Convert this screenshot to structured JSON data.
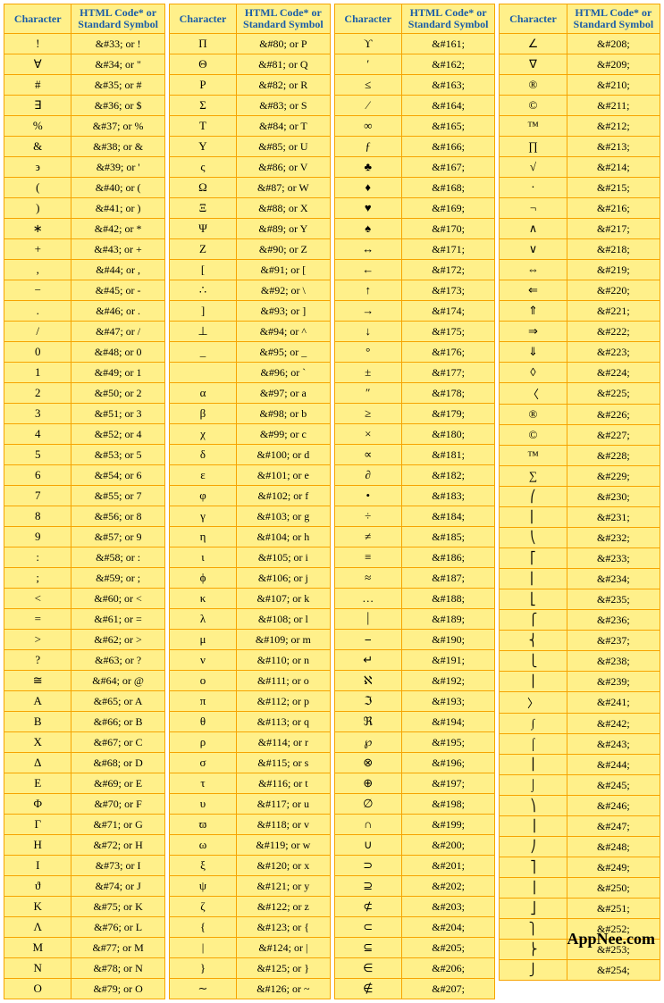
{
  "headers": {
    "char": "Character",
    "code": "HTML Code* or Standard Symbol"
  },
  "brand": "AppNee.com",
  "columns": [
    [
      [
        "!",
        "&#33;  or  !"
      ],
      [
        "∀",
        "&#34;  or  \""
      ],
      [
        "#",
        "&#35;  or  #"
      ],
      [
        "∃",
        "&#36;  or  $"
      ],
      [
        "%",
        "&#37;  or  %"
      ],
      [
        "&",
        "&#38;  or  &"
      ],
      [
        "϶",
        "&#39;  or  '"
      ],
      [
        "(",
        "&#40;  or  ("
      ],
      [
        ")",
        "&#41;  or  )"
      ],
      [
        "∗",
        "&#42;  or  *"
      ],
      [
        "+",
        "&#43;  or  +"
      ],
      [
        ",",
        "&#44;  or  ,"
      ],
      [
        "−",
        "&#45;  or  -"
      ],
      [
        ".",
        "&#46;  or  ."
      ],
      [
        "/",
        "&#47;  or  /"
      ],
      [
        "0",
        "&#48;  or  0"
      ],
      [
        "1",
        "&#49;  or  1"
      ],
      [
        "2",
        "&#50;  or  2"
      ],
      [
        "3",
        "&#51;  or  3"
      ],
      [
        "4",
        "&#52;  or  4"
      ],
      [
        "5",
        "&#53;  or  5"
      ],
      [
        "6",
        "&#54;  or  6"
      ],
      [
        "7",
        "&#55;  or  7"
      ],
      [
        "8",
        "&#56;  or  8"
      ],
      [
        "9",
        "&#57;  or  9"
      ],
      [
        ":",
        "&#58;  or  :"
      ],
      [
        ";",
        "&#59;  or  ;"
      ],
      [
        "<",
        "&#60;  or  <"
      ],
      [
        "=",
        "&#61;  or  ="
      ],
      [
        ">",
        "&#62;  or  >"
      ],
      [
        "?",
        "&#63;  or  ?"
      ],
      [
        "≅",
        "&#64;  or  @"
      ],
      [
        "Α",
        "&#65;  or  A"
      ],
      [
        "Β",
        "&#66;  or  B"
      ],
      [
        "Χ",
        "&#67;  or  C"
      ],
      [
        "Δ",
        "&#68;  or  D"
      ],
      [
        "Ε",
        "&#69;  or  E"
      ],
      [
        "Φ",
        "&#70;  or  F"
      ],
      [
        "Γ",
        "&#71;  or  G"
      ],
      [
        "Η",
        "&#72;  or  H"
      ],
      [
        "Ι",
        "&#73;  or  I"
      ],
      [
        "ϑ",
        "&#74;  or  J"
      ],
      [
        "Κ",
        "&#75;  or  K"
      ],
      [
        "Λ",
        "&#76;  or  L"
      ],
      [
        "Μ",
        "&#77;  or  M"
      ],
      [
        "Ν",
        "&#78;  or  N"
      ],
      [
        "Ο",
        "&#79;  or  O"
      ]
    ],
    [
      [
        "Π",
        "&#80;  or  P"
      ],
      [
        "Θ",
        "&#81;  or  Q"
      ],
      [
        "Ρ",
        "&#82;  or  R"
      ],
      [
        "Σ",
        "&#83;  or  S"
      ],
      [
        "Τ",
        "&#84;  or  T"
      ],
      [
        "Υ",
        "&#85;  or  U"
      ],
      [
        "ς",
        "&#86;  or  V"
      ],
      [
        "Ω",
        "&#87;  or  W"
      ],
      [
        "Ξ",
        "&#88;  or  X"
      ],
      [
        "Ψ",
        "&#89;  or  Y"
      ],
      [
        "Ζ",
        "&#90;  or  Z"
      ],
      [
        "[",
        "&#91;  or  ["
      ],
      [
        "∴",
        "&#92;  or  \\"
      ],
      [
        "]",
        "&#93;  or  ]"
      ],
      [
        "⊥",
        "&#94;  or  ^"
      ],
      [
        "_",
        "&#95;  or  _"
      ],
      [
        "",
        "&#96;  or  `"
      ],
      [
        "α",
        "&#97;  or  a"
      ],
      [
        "β",
        "&#98;  or  b"
      ],
      [
        "χ",
        "&#99;  or  c"
      ],
      [
        "δ",
        "&#100;  or  d"
      ],
      [
        "ε",
        "&#101;  or  e"
      ],
      [
        "φ",
        "&#102;  or  f"
      ],
      [
        "γ",
        "&#103;  or  g"
      ],
      [
        "η",
        "&#104;  or  h"
      ],
      [
        "ι",
        "&#105;  or  i"
      ],
      [
        "ϕ",
        "&#106;  or  j"
      ],
      [
        "κ",
        "&#107;  or  k"
      ],
      [
        "λ",
        "&#108;  or  l"
      ],
      [
        "μ",
        "&#109;  or  m"
      ],
      [
        "ν",
        "&#110;  or  n"
      ],
      [
        "ο",
        "&#111;  or  o"
      ],
      [
        "π",
        "&#112;  or  p"
      ],
      [
        "θ",
        "&#113;  or  q"
      ],
      [
        "ρ",
        "&#114;  or  r"
      ],
      [
        "σ",
        "&#115;  or  s"
      ],
      [
        "τ",
        "&#116;  or  t"
      ],
      [
        "υ",
        "&#117;  or  u"
      ],
      [
        "ϖ",
        "&#118;  or  v"
      ],
      [
        "ω",
        "&#119;  or  w"
      ],
      [
        "ξ",
        "&#120;  or  x"
      ],
      [
        "ψ",
        "&#121;  or  y"
      ],
      [
        "ζ",
        "&#122;  or  z"
      ],
      [
        "{",
        "&#123;  or  {"
      ],
      [
        "|",
        "&#124;  or  |"
      ],
      [
        "}",
        "&#125;  or  }"
      ],
      [
        "∼",
        "&#126;  or  ~"
      ]
    ],
    [
      [
        "ϒ",
        "&#161;"
      ],
      [
        "′",
        "&#162;"
      ],
      [
        "≤",
        "&#163;"
      ],
      [
        "⁄",
        "&#164;"
      ],
      [
        "∞",
        "&#165;"
      ],
      [
        "ƒ",
        "&#166;"
      ],
      [
        "♣",
        "&#167;"
      ],
      [
        "♦",
        "&#168;"
      ],
      [
        "♥",
        "&#169;"
      ],
      [
        "♠",
        "&#170;"
      ],
      [
        "↔",
        "&#171;"
      ],
      [
        "←",
        "&#172;"
      ],
      [
        "↑",
        "&#173;"
      ],
      [
        "→",
        "&#174;"
      ],
      [
        "↓",
        "&#175;"
      ],
      [
        "°",
        "&#176;"
      ],
      [
        "±",
        "&#177;"
      ],
      [
        "″",
        "&#178;"
      ],
      [
        "≥",
        "&#179;"
      ],
      [
        "×",
        "&#180;"
      ],
      [
        "∝",
        "&#181;"
      ],
      [
        "∂",
        "&#182;"
      ],
      [
        "•",
        "&#183;"
      ],
      [
        "÷",
        "&#184;"
      ],
      [
        "≠",
        "&#185;"
      ],
      [
        "≡",
        "&#186;"
      ],
      [
        "≈",
        "&#187;"
      ],
      [
        "…",
        "&#188;"
      ],
      [
        "⏐",
        "&#189;"
      ],
      [
        "⎯",
        "&#190;"
      ],
      [
        "↵",
        "&#191;"
      ],
      [
        "ℵ",
        "&#192;"
      ],
      [
        "ℑ",
        "&#193;"
      ],
      [
        "ℜ",
        "&#194;"
      ],
      [
        "℘",
        "&#195;"
      ],
      [
        "⊗",
        "&#196;"
      ],
      [
        "⊕",
        "&#197;"
      ],
      [
        "∅",
        "&#198;"
      ],
      [
        "∩",
        "&#199;"
      ],
      [
        "∪",
        "&#200;"
      ],
      [
        "⊃",
        "&#201;"
      ],
      [
        "⊇",
        "&#202;"
      ],
      [
        "⊄",
        "&#203;"
      ],
      [
        "⊂",
        "&#204;"
      ],
      [
        "⊆",
        "&#205;"
      ],
      [
        "∈",
        "&#206;"
      ],
      [
        "∉",
        "&#207;"
      ]
    ],
    [
      [
        "∠",
        "&#208;"
      ],
      [
        "∇",
        "&#209;"
      ],
      [
        "®",
        "&#210;"
      ],
      [
        "©",
        "&#211;"
      ],
      [
        "™",
        "&#212;"
      ],
      [
        "∏",
        "&#213;"
      ],
      [
        "√",
        "&#214;"
      ],
      [
        "⋅",
        "&#215;"
      ],
      [
        "¬",
        "&#216;"
      ],
      [
        "∧",
        "&#217;"
      ],
      [
        "∨",
        "&#218;"
      ],
      [
        "⇔",
        "&#219;"
      ],
      [
        "⇐",
        "&#220;"
      ],
      [
        "⇑",
        "&#221;"
      ],
      [
        "⇒",
        "&#222;"
      ],
      [
        "⇓",
        "&#223;"
      ],
      [
        "◊",
        "&#224;"
      ],
      [
        "〈",
        "&#225;"
      ],
      [
        "®",
        "&#226;"
      ],
      [
        "©",
        "&#227;"
      ],
      [
        "™",
        "&#228;"
      ],
      [
        "∑",
        "&#229;"
      ],
      [
        "⎛",
        "&#230;"
      ],
      [
        "⎜",
        "&#231;"
      ],
      [
        "⎝",
        "&#232;"
      ],
      [
        "⎡",
        "&#233;"
      ],
      [
        "⎢",
        "&#234;"
      ],
      [
        "⎣",
        "&#235;"
      ],
      [
        "⎧",
        "&#236;"
      ],
      [
        "⎨",
        "&#237;"
      ],
      [
        "⎩",
        "&#238;"
      ],
      [
        "⎪",
        "&#239;"
      ],
      [
        "〉",
        "&#241;"
      ],
      [
        "∫",
        "&#242;"
      ],
      [
        "⌠",
        "&#243;"
      ],
      [
        "⎮",
        "&#244;"
      ],
      [
        "⌡",
        "&#245;"
      ],
      [
        "⎞",
        "&#246;"
      ],
      [
        "⎟",
        "&#247;"
      ],
      [
        "⎠",
        "&#248;"
      ],
      [
        "⎤",
        "&#249;"
      ],
      [
        "⎥",
        "&#250;"
      ],
      [
        "⎦",
        "&#251;"
      ],
      [
        "⎫",
        "&#252;"
      ],
      [
        "⎬",
        "&#253;"
      ],
      [
        "⎭",
        "&#254;"
      ]
    ]
  ]
}
